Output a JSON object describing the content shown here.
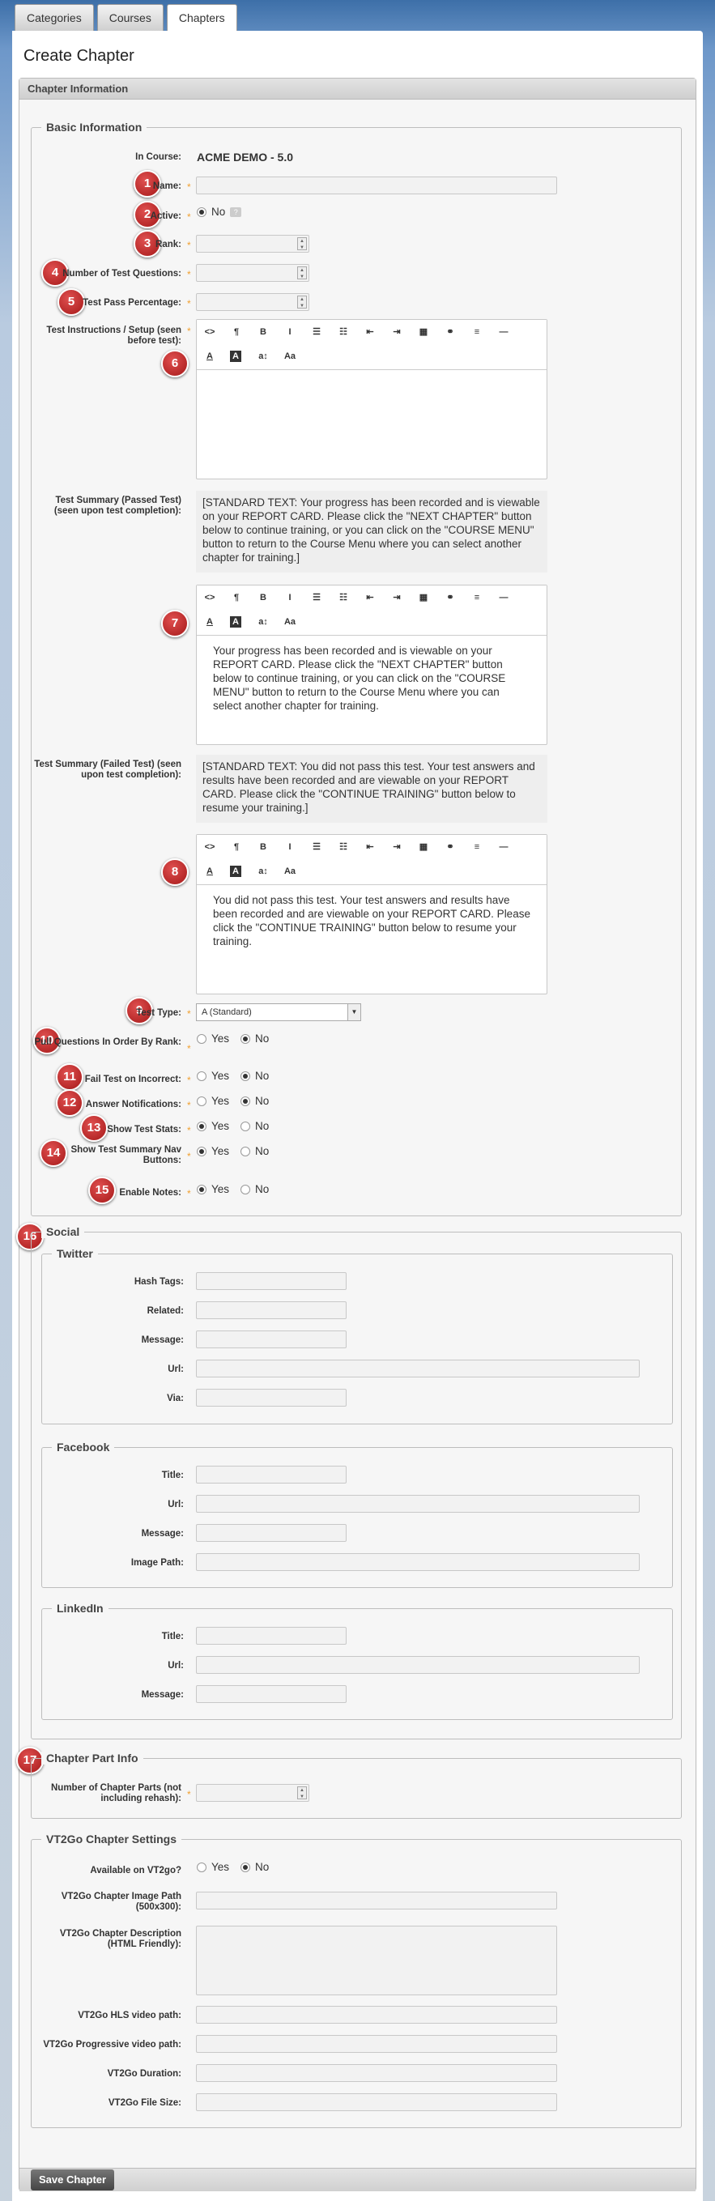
{
  "tabs": [
    {
      "label": "Categories"
    },
    {
      "label": "Courses"
    },
    {
      "label": "Chapters"
    }
  ],
  "page_title": "Create Chapter",
  "panel_title": "Chapter Information",
  "basic": {
    "legend": "Basic Information",
    "in_course_label": "In Course:",
    "in_course_value": "ACME DEMO - 5.0",
    "name_label": "Name:",
    "active_label": "Active:",
    "active_option": "No",
    "rank_label": "Rank:",
    "num_questions_label": "Number of Test Questions:",
    "pass_pct_label": "Test Pass Percentage:",
    "instructions_label": "Test Instructions / Setup (seen before test):",
    "summary_passed_label": "Test Summary (Passed Test) (seen upon test completion):",
    "summary_passed_std": "[STANDARD TEXT: Your progress has been recorded and is viewable on your REPORT CARD. Please click the \"NEXT CHAPTER\" button below to continue training, or you can click on the \"COURSE MENU\" button to return to the Course Menu where you can select another chapter for training.]",
    "summary_passed_text": "Your progress has been recorded and is viewable on your REPORT CARD. Please click the \"NEXT CHAPTER\" button below to continue training, or you can click on the \"COURSE MENU\" button to return to the Course Menu where you can select another chapter for training.",
    "summary_failed_label": "Test Summary (Failed Test) (seen upon test completion):",
    "summary_failed_std": "[STANDARD TEXT: You did not pass this test. Your test answers and results have been recorded and are viewable on your REPORT CARD. Please click the \"CONTINUE TRAINING\" button below to resume your training.]",
    "summary_failed_text": "You did not pass this test. Your test answers and results have been recorded and are viewable on your REPORT CARD. Please click the \"CONTINUE TRAINING\" button below to resume your training.",
    "test_type_label": "Test Type:",
    "test_type_value": "A (Standard)",
    "pull_label": "Pull Questions In Order By Rank:",
    "fail_label": "Fail Test on Incorrect:",
    "answer_label": "Answer Notifications:",
    "stats_label": "Show Test Stats:",
    "summary_nav_label": "Show Test Summary Nav Buttons:",
    "notes_label": "Enable Notes:",
    "yes": "Yes",
    "no": "No"
  },
  "social": {
    "legend": "Social",
    "twitter": {
      "legend": "Twitter",
      "hashtags": "Hash Tags:",
      "related": "Related:",
      "message": "Message:",
      "url": "Url:",
      "via": "Via:"
    },
    "facebook": {
      "legend": "Facebook",
      "title": "Title:",
      "url": "Url:",
      "message": "Message:",
      "image": "Image Path:"
    },
    "linkedin": {
      "legend": "LinkedIn",
      "title": "Title:",
      "url": "Url:",
      "message": "Message:"
    }
  },
  "part": {
    "legend": "Chapter Part Info",
    "parts_label": "Number of Chapter Parts (not including rehash):"
  },
  "vt2go": {
    "legend": "VT2Go Chapter Settings",
    "available": "Available on VT2go?",
    "image": "VT2Go Chapter Image Path (500x300):",
    "desc": "VT2Go Chapter Description (HTML Friendly):",
    "hls": "VT2Go HLS video path:",
    "progressive": "VT2Go Progressive video path:",
    "duration": "VT2Go Duration:",
    "filesize": "VT2Go File Size:"
  },
  "save_label": "Save Chapter",
  "badges": [
    "1",
    "2",
    "3",
    "4",
    "5",
    "6",
    "7",
    "8",
    "9",
    "10",
    "11",
    "12",
    "13",
    "14",
    "15",
    "16",
    "17"
  ],
  "toolbar_row1": [
    "<>",
    "¶",
    "B",
    "I",
    "☰",
    "☷",
    "⇤",
    "⇥",
    "▦",
    "⚭",
    "≡",
    "—"
  ],
  "toolbar_row2": [
    "A",
    "A",
    "a↕",
    "Aa"
  ]
}
